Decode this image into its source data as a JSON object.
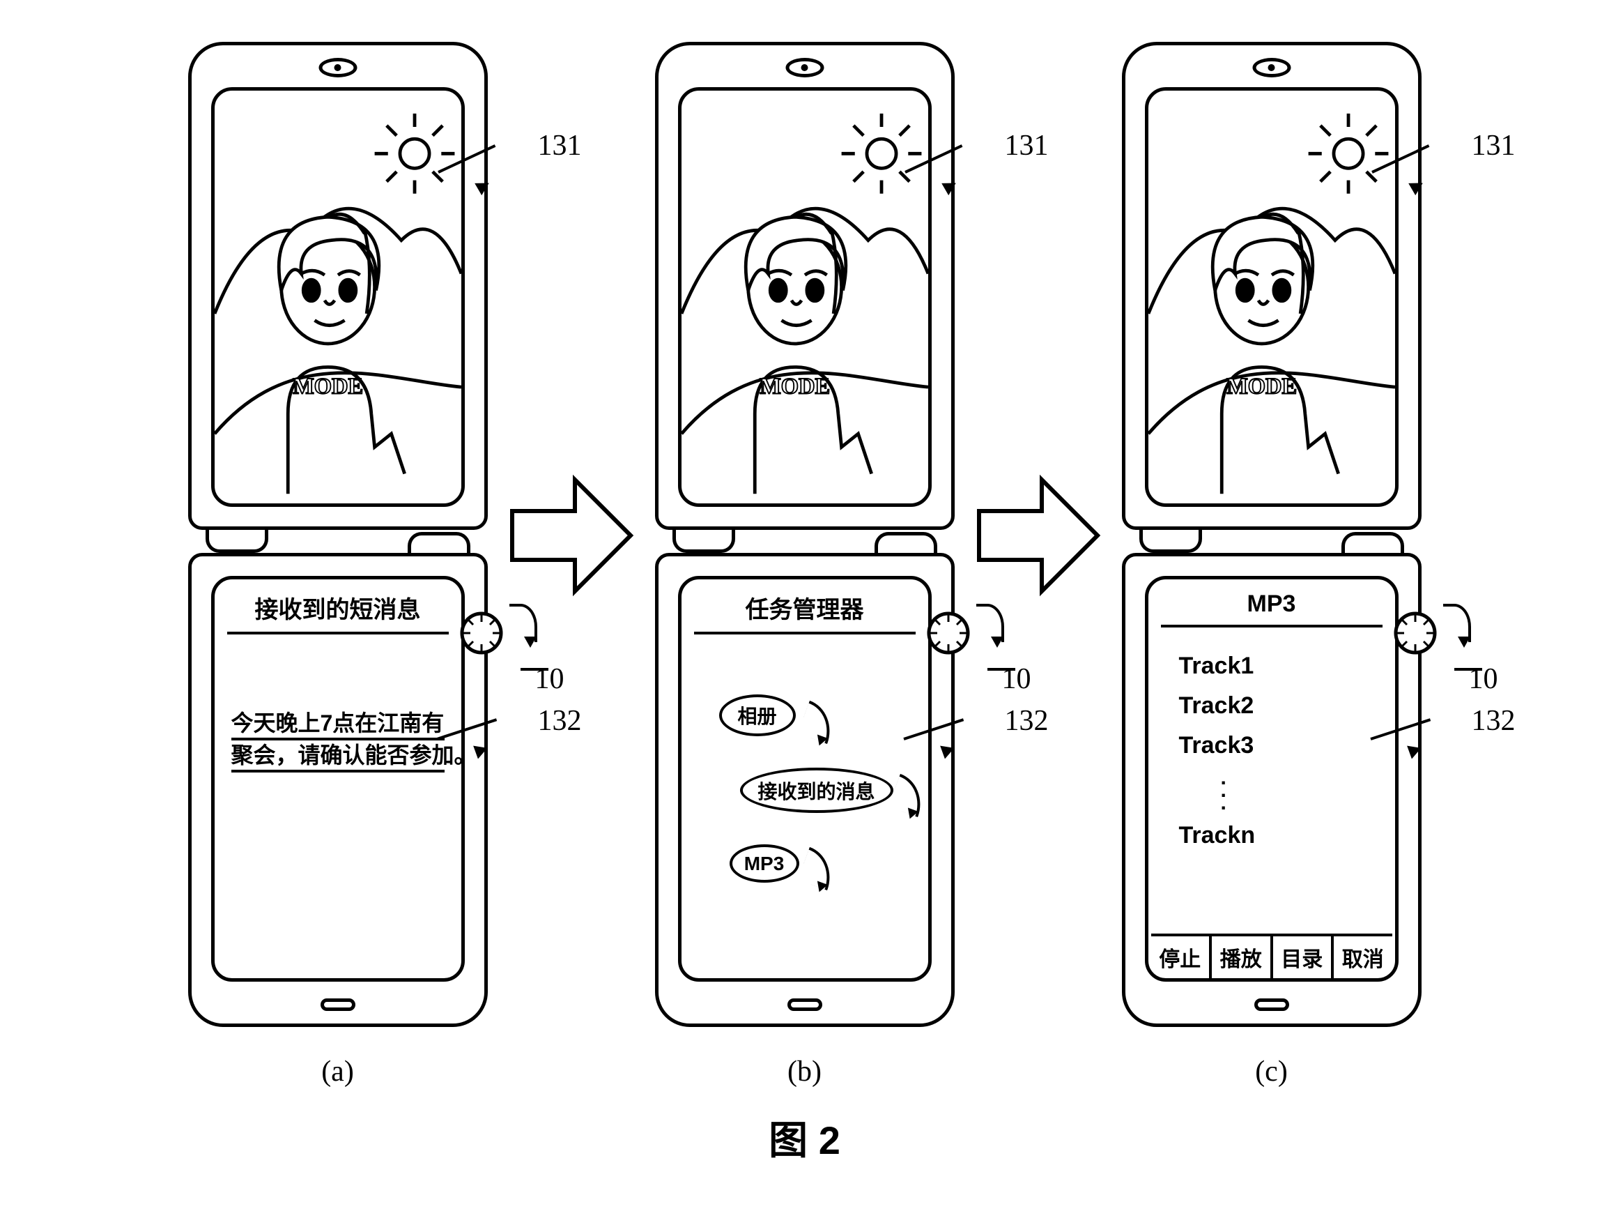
{
  "shared": {
    "shirt_text": "MODE",
    "ref_top": "131",
    "ref_bottom": "132",
    "ref_wheel": "10"
  },
  "phone_a": {
    "caption": "(a)",
    "screen_title": "接收到的短消息",
    "sms_line1": "今天晚上7点在江南有",
    "sms_line2": "聚会，请确认能否参加。"
  },
  "phone_b": {
    "caption": "(b)",
    "screen_title": "任务管理器",
    "bubble1": "相册",
    "bubble2": "接收到的消息",
    "bubble3": "MP3"
  },
  "phone_c": {
    "caption": "(c)",
    "screen_title": "MP3",
    "tracks": [
      "Track1",
      "Track2",
      "Track3",
      "Trackn"
    ],
    "softkeys": [
      "停止",
      "播放",
      "目录",
      "取消"
    ]
  },
  "figure_label": "图 2"
}
